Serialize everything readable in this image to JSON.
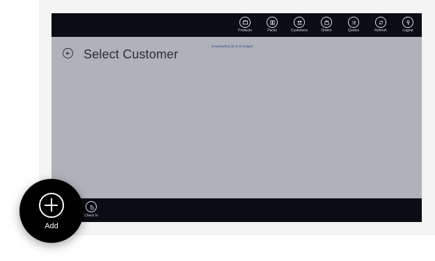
{
  "topbar": {
    "nav": [
      {
        "label": "Products",
        "icon": "products-icon"
      },
      {
        "label": "Packs",
        "icon": "packs-icon"
      },
      {
        "label": "Customers",
        "icon": "customers-icon"
      },
      {
        "label": "Orders",
        "icon": "orders-icon"
      },
      {
        "label": "Quotes",
        "icon": "quotes-icon"
      },
      {
        "label": "Refresh",
        "icon": "refresh-icon"
      },
      {
        "label": "Logout",
        "icon": "logout-icon"
      }
    ]
  },
  "main": {
    "status": "Downloading 35 of 43 images",
    "title": "Select Customer",
    "back_icon": "back-arrow-icon"
  },
  "bottombar": {
    "checkin": {
      "label": "Check In",
      "icon": "hand-icon"
    }
  },
  "fab": {
    "label": "Add",
    "icon": "plus-icon"
  },
  "colors": {
    "bar": "#0b0d14",
    "content_bg": "#b0b2b9",
    "status_text": "#2a4a8a",
    "title_text": "#2a2c33"
  }
}
